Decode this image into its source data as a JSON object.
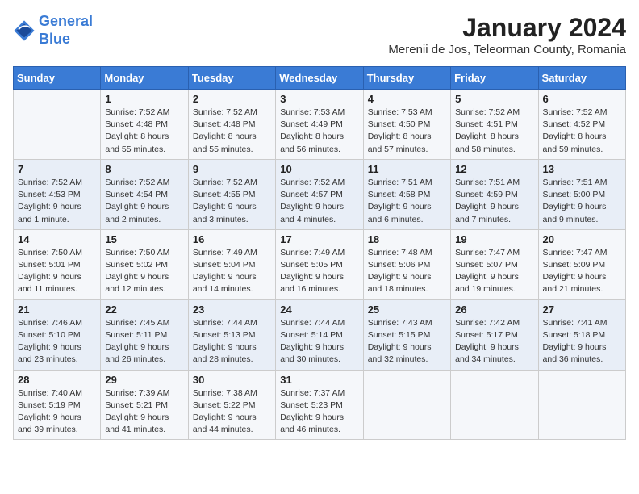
{
  "logo": {
    "line1": "General",
    "line2": "Blue"
  },
  "title": "January 2024",
  "subtitle": "Merenii de Jos, Teleorman County, Romania",
  "weekdays": [
    "Sunday",
    "Monday",
    "Tuesday",
    "Wednesday",
    "Thursday",
    "Friday",
    "Saturday"
  ],
  "weeks": [
    [
      {
        "day": "",
        "sunrise": "",
        "sunset": "",
        "daylight": ""
      },
      {
        "day": "1",
        "sunrise": "Sunrise: 7:52 AM",
        "sunset": "Sunset: 4:48 PM",
        "daylight": "Daylight: 8 hours and 55 minutes."
      },
      {
        "day": "2",
        "sunrise": "Sunrise: 7:52 AM",
        "sunset": "Sunset: 4:48 PM",
        "daylight": "Daylight: 8 hours and 55 minutes."
      },
      {
        "day": "3",
        "sunrise": "Sunrise: 7:53 AM",
        "sunset": "Sunset: 4:49 PM",
        "daylight": "Daylight: 8 hours and 56 minutes."
      },
      {
        "day": "4",
        "sunrise": "Sunrise: 7:53 AM",
        "sunset": "Sunset: 4:50 PM",
        "daylight": "Daylight: 8 hours and 57 minutes."
      },
      {
        "day": "5",
        "sunrise": "Sunrise: 7:52 AM",
        "sunset": "Sunset: 4:51 PM",
        "daylight": "Daylight: 8 hours and 58 minutes."
      },
      {
        "day": "6",
        "sunrise": "Sunrise: 7:52 AM",
        "sunset": "Sunset: 4:52 PM",
        "daylight": "Daylight: 8 hours and 59 minutes."
      }
    ],
    [
      {
        "day": "7",
        "sunrise": "Sunrise: 7:52 AM",
        "sunset": "Sunset: 4:53 PM",
        "daylight": "Daylight: 9 hours and 1 minute."
      },
      {
        "day": "8",
        "sunrise": "Sunrise: 7:52 AM",
        "sunset": "Sunset: 4:54 PM",
        "daylight": "Daylight: 9 hours and 2 minutes."
      },
      {
        "day": "9",
        "sunrise": "Sunrise: 7:52 AM",
        "sunset": "Sunset: 4:55 PM",
        "daylight": "Daylight: 9 hours and 3 minutes."
      },
      {
        "day": "10",
        "sunrise": "Sunrise: 7:52 AM",
        "sunset": "Sunset: 4:57 PM",
        "daylight": "Daylight: 9 hours and 4 minutes."
      },
      {
        "day": "11",
        "sunrise": "Sunrise: 7:51 AM",
        "sunset": "Sunset: 4:58 PM",
        "daylight": "Daylight: 9 hours and 6 minutes."
      },
      {
        "day": "12",
        "sunrise": "Sunrise: 7:51 AM",
        "sunset": "Sunset: 4:59 PM",
        "daylight": "Daylight: 9 hours and 7 minutes."
      },
      {
        "day": "13",
        "sunrise": "Sunrise: 7:51 AM",
        "sunset": "Sunset: 5:00 PM",
        "daylight": "Daylight: 9 hours and 9 minutes."
      }
    ],
    [
      {
        "day": "14",
        "sunrise": "Sunrise: 7:50 AM",
        "sunset": "Sunset: 5:01 PM",
        "daylight": "Daylight: 9 hours and 11 minutes."
      },
      {
        "day": "15",
        "sunrise": "Sunrise: 7:50 AM",
        "sunset": "Sunset: 5:02 PM",
        "daylight": "Daylight: 9 hours and 12 minutes."
      },
      {
        "day": "16",
        "sunrise": "Sunrise: 7:49 AM",
        "sunset": "Sunset: 5:04 PM",
        "daylight": "Daylight: 9 hours and 14 minutes."
      },
      {
        "day": "17",
        "sunrise": "Sunrise: 7:49 AM",
        "sunset": "Sunset: 5:05 PM",
        "daylight": "Daylight: 9 hours and 16 minutes."
      },
      {
        "day": "18",
        "sunrise": "Sunrise: 7:48 AM",
        "sunset": "Sunset: 5:06 PM",
        "daylight": "Daylight: 9 hours and 18 minutes."
      },
      {
        "day": "19",
        "sunrise": "Sunrise: 7:47 AM",
        "sunset": "Sunset: 5:07 PM",
        "daylight": "Daylight: 9 hours and 19 minutes."
      },
      {
        "day": "20",
        "sunrise": "Sunrise: 7:47 AM",
        "sunset": "Sunset: 5:09 PM",
        "daylight": "Daylight: 9 hours and 21 minutes."
      }
    ],
    [
      {
        "day": "21",
        "sunrise": "Sunrise: 7:46 AM",
        "sunset": "Sunset: 5:10 PM",
        "daylight": "Daylight: 9 hours and 23 minutes."
      },
      {
        "day": "22",
        "sunrise": "Sunrise: 7:45 AM",
        "sunset": "Sunset: 5:11 PM",
        "daylight": "Daylight: 9 hours and 26 minutes."
      },
      {
        "day": "23",
        "sunrise": "Sunrise: 7:44 AM",
        "sunset": "Sunset: 5:13 PM",
        "daylight": "Daylight: 9 hours and 28 minutes."
      },
      {
        "day": "24",
        "sunrise": "Sunrise: 7:44 AM",
        "sunset": "Sunset: 5:14 PM",
        "daylight": "Daylight: 9 hours and 30 minutes."
      },
      {
        "day": "25",
        "sunrise": "Sunrise: 7:43 AM",
        "sunset": "Sunset: 5:15 PM",
        "daylight": "Daylight: 9 hours and 32 minutes."
      },
      {
        "day": "26",
        "sunrise": "Sunrise: 7:42 AM",
        "sunset": "Sunset: 5:17 PM",
        "daylight": "Daylight: 9 hours and 34 minutes."
      },
      {
        "day": "27",
        "sunrise": "Sunrise: 7:41 AM",
        "sunset": "Sunset: 5:18 PM",
        "daylight": "Daylight: 9 hours and 36 minutes."
      }
    ],
    [
      {
        "day": "28",
        "sunrise": "Sunrise: 7:40 AM",
        "sunset": "Sunset: 5:19 PM",
        "daylight": "Daylight: 9 hours and 39 minutes."
      },
      {
        "day": "29",
        "sunrise": "Sunrise: 7:39 AM",
        "sunset": "Sunset: 5:21 PM",
        "daylight": "Daylight: 9 hours and 41 minutes."
      },
      {
        "day": "30",
        "sunrise": "Sunrise: 7:38 AM",
        "sunset": "Sunset: 5:22 PM",
        "daylight": "Daylight: 9 hours and 44 minutes."
      },
      {
        "day": "31",
        "sunrise": "Sunrise: 7:37 AM",
        "sunset": "Sunset: 5:23 PM",
        "daylight": "Daylight: 9 hours and 46 minutes."
      },
      {
        "day": "",
        "sunrise": "",
        "sunset": "",
        "daylight": ""
      },
      {
        "day": "",
        "sunrise": "",
        "sunset": "",
        "daylight": ""
      },
      {
        "day": "",
        "sunrise": "",
        "sunset": "",
        "daylight": ""
      }
    ]
  ]
}
